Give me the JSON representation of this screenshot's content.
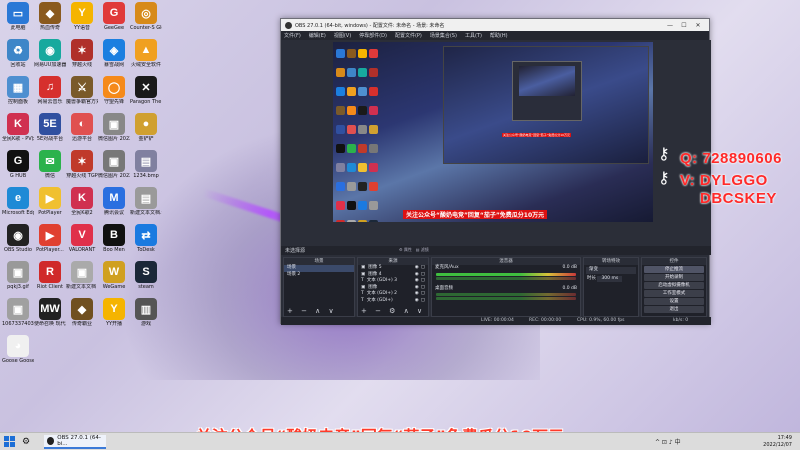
{
  "desktop": {
    "icons": [
      {
        "label": "此电脑",
        "glyph": "▭",
        "color": "#2a78d6"
      },
      {
        "label": "热血传奇",
        "glyph": "◆",
        "color": "#8a5a1e"
      },
      {
        "label": "YY语音",
        "glyph": "Y",
        "color": "#f5b400"
      },
      {
        "label": "GeeGee",
        "glyph": "G",
        "color": "#e03a3a"
      },
      {
        "label": "Counter-S Global Off...",
        "glyph": "◎",
        "color": "#d78a1a"
      },
      {
        "label": "回收站",
        "glyph": "♻",
        "color": "#3e86c8"
      },
      {
        "label": "网易UU加速器",
        "glyph": "◉",
        "color": "#17a99e"
      },
      {
        "label": "穿越火线",
        "glyph": "✶",
        "color": "#b0302a"
      },
      {
        "label": "暴雪战网",
        "glyph": "◈",
        "color": "#1b7fe0"
      },
      {
        "label": "火绒安全软件",
        "glyph": "▲",
        "color": "#f0a020"
      },
      {
        "label": "控制面板",
        "glyph": "▦",
        "color": "#4e8fd0"
      },
      {
        "label": "网易云音乐",
        "glyph": "♫",
        "color": "#d6302d"
      },
      {
        "label": "魔兽争霸官方对战平台",
        "glyph": "⚔",
        "color": "#7a5a2a"
      },
      {
        "label": "守望先锋",
        "glyph": "◯",
        "color": "#f58a1a"
      },
      {
        "label": "Paragon The Over...",
        "glyph": "✕",
        "color": "#1a1a1a"
      },
      {
        "label": "全民K歌 - PV比赛版",
        "glyph": "K",
        "color": "#d03050"
      },
      {
        "label": "5E对战平台",
        "glyph": "5E",
        "color": "#3050a0"
      },
      {
        "label": "迅游平台",
        "glyph": "◐",
        "color": "#e05050"
      },
      {
        "label": "微信图片 20221207...",
        "glyph": "▣",
        "color": "#888888"
      },
      {
        "label": "金铲铲",
        "glyph": "●",
        "color": "#d0a030"
      },
      {
        "label": "G HUB",
        "glyph": "G",
        "color": "#111111"
      },
      {
        "label": "微信",
        "glyph": "✉",
        "color": "#2bb24c"
      },
      {
        "label": "穿越火线 TGP",
        "glyph": "✶",
        "color": "#c03a2a"
      },
      {
        "label": "微信图片 20221207...",
        "glyph": "▣",
        "color": "#777777"
      },
      {
        "label": "1234.bmp",
        "glyph": "▤",
        "color": "#8080a0"
      },
      {
        "label": "Microsoft Edge",
        "glyph": "e",
        "color": "#1f8ad6"
      },
      {
        "label": "PotPlayer",
        "glyph": "▶",
        "color": "#f0c030"
      },
      {
        "label": "全民K歌2",
        "glyph": "K",
        "color": "#d03050"
      },
      {
        "label": "腾讯会议",
        "glyph": "M",
        "color": "#2a6fe0"
      },
      {
        "label": "新建文本文档.txt",
        "glyph": "▤",
        "color": "#9a9a9a"
      },
      {
        "label": "OBS Studio",
        "glyph": "◉",
        "color": "#222222"
      },
      {
        "label": "PotPlayer...",
        "glyph": "▶",
        "color": "#e04030"
      },
      {
        "label": "VALORANT",
        "glyph": "V",
        "color": "#e0304a"
      },
      {
        "label": "Boo Men",
        "glyph": "B",
        "color": "#111111"
      },
      {
        "label": "ToDesk",
        "glyph": "⇄",
        "color": "#1a7ae0"
      },
      {
        "label": "pqkj3.gif",
        "glyph": "▣",
        "color": "#999999"
      },
      {
        "label": "Riot Client",
        "glyph": "R",
        "color": "#d02a2a"
      },
      {
        "label": "新建文本文档 11.6.png",
        "glyph": "▣",
        "color": "#aaaaaa"
      },
      {
        "label": "WeGame",
        "glyph": "W",
        "color": "#d0a020"
      },
      {
        "label": "steam",
        "glyph": "S",
        "color": "#1b2838"
      },
      {
        "label": "1067337403 加入广告...",
        "glyph": "▣",
        "color": "#a0a0a0"
      },
      {
        "label": "使命召唤 现代战争...",
        "glyph": "MW",
        "color": "#222222"
      },
      {
        "label": "传奇霸业",
        "glyph": "◆",
        "color": "#705020"
      },
      {
        "label": "YY开播",
        "glyph": "Y",
        "color": "#f5b400"
      },
      {
        "label": "游戏",
        "glyph": "▥",
        "color": "#555555"
      },
      {
        "label": "Goose Goose Duck",
        "glyph": "◕",
        "color": "#f0f0f0"
      }
    ]
  },
  "obs": {
    "title": "OBS 27.0.1 (64-bit, windows) - 配置文件: 未命名 - 场景: 未命名",
    "window_controls": [
      "—",
      "☐",
      "✕"
    ],
    "menu": [
      "文件(F)",
      "编辑(E)",
      "视图(V)",
      "停靠部件(D)",
      "配置文件(P)",
      "场景集合(S)",
      "工具(T)",
      "帮助(H)"
    ],
    "preview_caption": "关注公众号“酸奶电竞”回复“茄子”免费瓜分10万元",
    "scene_header": "未选择源",
    "source_tools": [
      "⚙ 属性",
      "▤ 滤镜"
    ],
    "scenes": {
      "title": "场景",
      "items": [
        "场景",
        "场景 2"
      ]
    },
    "sources": {
      "title": "来源",
      "items": [
        {
          "icon": "▣",
          "name": "图像 5"
        },
        {
          "icon": "▣",
          "name": "图像 4"
        },
        {
          "icon": "T",
          "name": "文本 (GDI+) 3"
        },
        {
          "icon": "▣",
          "name": "图像"
        },
        {
          "icon": "T",
          "name": "文本 (GDI+) 2"
        },
        {
          "icon": "T",
          "name": "文本 (GDI+)"
        }
      ]
    },
    "mixer": {
      "title": "混音器",
      "tracks": [
        {
          "name": "麦克风/Aux",
          "db": "0.0 dB"
        },
        {
          "name": "桌面音频",
          "db": "0.0 dB"
        }
      ]
    },
    "transitions": {
      "title": "转场特效",
      "type": "渐变",
      "duration_label": "时长",
      "duration_value": "300 ms"
    },
    "controls": {
      "title": "控件",
      "buttons": [
        "停止推流",
        "开始录制",
        "启动虚拟摄像机",
        "工作室模式",
        "设置",
        "退出"
      ]
    },
    "status": {
      "live": "LIVE: 00:00:04",
      "rec": "REC: 00:00:00",
      "cpu": "CPU: 0.9%, 60.00 fps",
      "kbps": "kb/s: 0"
    }
  },
  "overlay": {
    "line1": "Q: 728890606",
    "line2": "V: DYLGGO",
    "line3": "DBCSKEY"
  },
  "banner": "关注公众号“酸奶电竞”回复“茄子”免费瓜分10万元",
  "taskbar": {
    "app_label": "OBS 27.0.1 (64-bi...",
    "tray": "^ ⊡ ♪ 中",
    "time": "17:49",
    "date": "2022/12/07"
  }
}
